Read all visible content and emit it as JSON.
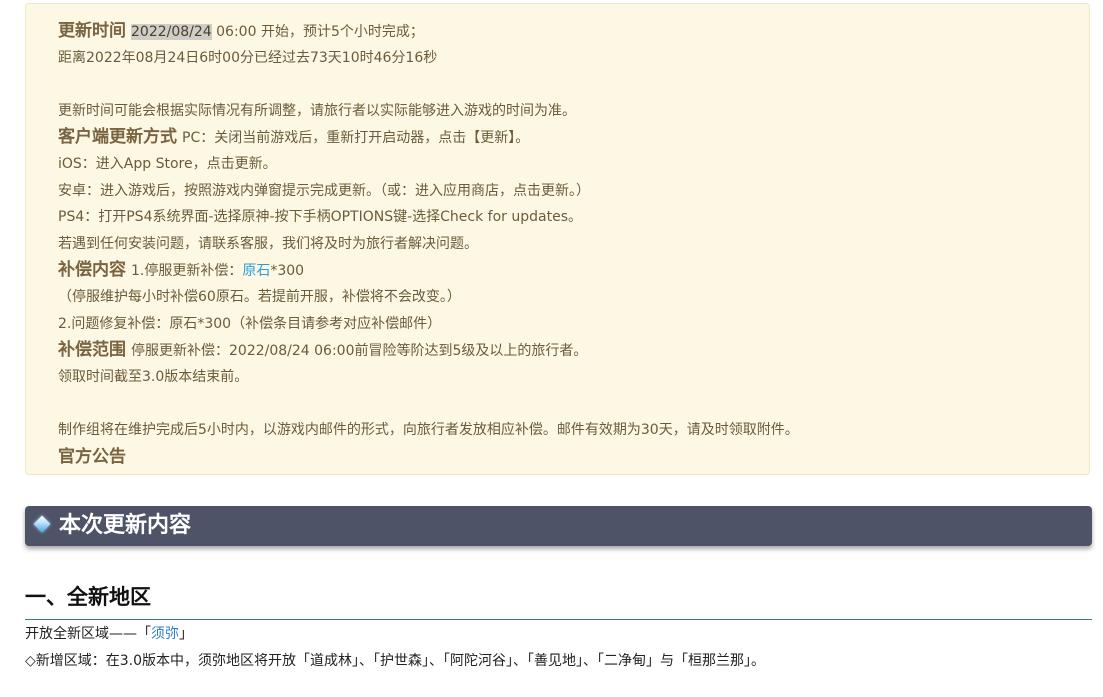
{
  "notice": {
    "update_time": {
      "label": "更新时间",
      "date": "2022/08/24",
      "rest": " 06:00 开始，预计5个小时完成；",
      "elapsed": "距离2022年08月24日6时00分已经过去73天10时46分16秒"
    },
    "adjust_note": "更新时间可能会根据实际情况有所调整，请旅行者以实际能够进入游戏的时间为准。",
    "client_update": {
      "label": "客户端更新方式",
      "pc": "PC：关闭当前游戏后，重新打开启动器，点击【更新】。",
      "ios": "iOS：进入App Store，点击更新。",
      "android": "安卓：进入游戏后，按照游戏内弹窗提示完成更新。（或：进入应用商店，点击更新。）",
      "ps4": "PS4：打开PS4系统界面-选择原神-按下手柄OPTIONS键-选择Check for updates。",
      "support": "若遇到任何安装问题，请联系客服，我们将及时为旅行者解决问题。"
    },
    "compensation": {
      "label": "补偿内容",
      "line1_prefix": "1.停服更新补偿：",
      "line1_link": "原石",
      "line1_suffix": "*300",
      "line2": "（停服维护每小时补偿60原石。若提前开服，补偿将不会改变。）",
      "line3": "2.问题修复补偿：原石*300（补偿条目请参考对应补偿邮件）"
    },
    "scope": {
      "label": "补偿范围",
      "line1": "停服更新补偿：2022/08/24 06:00前冒险等阶达到5级及以上的旅行者。",
      "line2": "领取时间截至3.0版本结束前。"
    },
    "mail_note": "制作组将在维护完成后5小时内，以游戏内邮件的形式，向旅行者发放相应补偿。邮件有效期为30天，请及时领取附件。",
    "official": "官方公告"
  },
  "section": {
    "title": "本次更新内容"
  },
  "subsection": {
    "title": "一、全新地区",
    "line1_prefix": "开放全新区域——「",
    "line1_link": "须弥",
    "line1_suffix": "」",
    "line2": "◇新增区域：在3.0版本中，须弥地区将开放「道成林」、「护世森」、「阿陀河谷」、「善见地」、「二净甸」与「桓那兰那」。"
  }
}
